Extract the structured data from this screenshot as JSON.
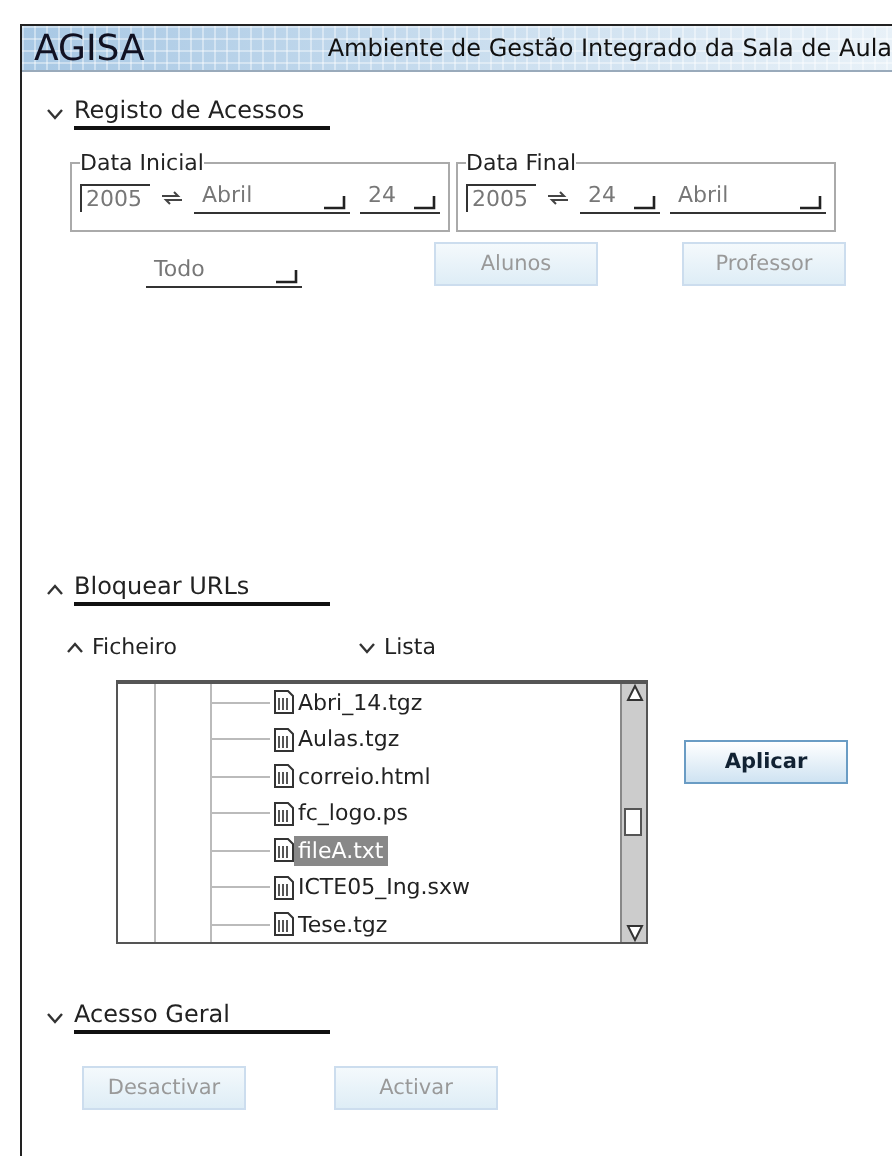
{
  "header": {
    "logo": "AGISA",
    "title": "Ambiente de Gestão Integrado da Sala de Aula"
  },
  "access_log": {
    "heading": "Registo de Acessos",
    "arrow_up": false,
    "start_date": {
      "legend": "Data Inicial",
      "year": "2005",
      "fields": [
        "Abril",
        "24"
      ]
    },
    "end_date": {
      "legend": "Data Final",
      "year": "2005",
      "fields": [
        "24",
        "Abril"
      ]
    },
    "filter": "Todo",
    "buttons": [
      {
        "label": "Alunos",
        "disabled": true
      },
      {
        "label": "Professor",
        "disabled": true
      }
    ]
  },
  "block_urls": {
    "heading": "Bloquear URLs",
    "arrow_up": true,
    "options": [
      {
        "label": "Ficheiro",
        "arrow_up": true
      },
      {
        "label": "Lista",
        "arrow_up": false
      }
    ],
    "files": [
      {
        "name": "Abri_14.tgz",
        "selected": false
      },
      {
        "name": "Aulas.tgz",
        "selected": false
      },
      {
        "name": "correio.html",
        "selected": false
      },
      {
        "name": "fc_logo.ps",
        "selected": false
      },
      {
        "name": "fileA.txt",
        "selected": true
      },
      {
        "name": "ICTE05_Ing.sxw",
        "selected": false
      },
      {
        "name": "Tese.tgz",
        "selected": false
      }
    ],
    "apply_button": {
      "label": "Aplicar",
      "disabled": false
    }
  },
  "general_access": {
    "heading": "Acesso Geral",
    "arrow_up": false,
    "buttons": [
      {
        "label": "Desactivar",
        "disabled": true
      },
      {
        "label": "Activar",
        "disabled": true
      }
    ]
  }
}
